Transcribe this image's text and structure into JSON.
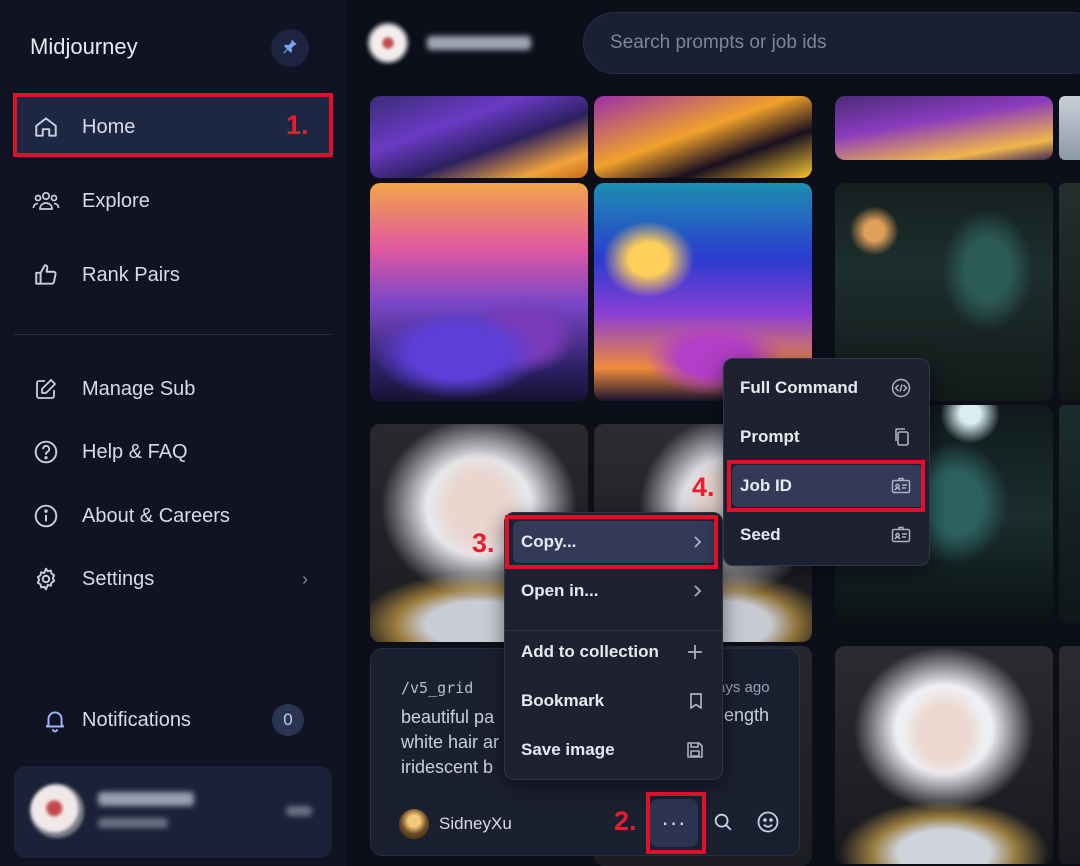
{
  "sidebar": {
    "brand": "Midjourney",
    "nav": [
      {
        "label": "Home",
        "icon": "home-icon"
      },
      {
        "label": "Explore",
        "icon": "people-icon"
      },
      {
        "label": "Rank Pairs",
        "icon": "thumbs-up-icon"
      },
      {
        "label": "Manage Sub",
        "icon": "edit-icon"
      },
      {
        "label": "Help & FAQ",
        "icon": "help-icon"
      },
      {
        "label": "About & Careers",
        "icon": "info-icon"
      },
      {
        "label": "Settings",
        "icon": "gear-icon"
      }
    ],
    "notifications": {
      "label": "Notifications",
      "count": "0"
    }
  },
  "search": {
    "placeholder": "Search prompts or job ids"
  },
  "detail": {
    "tag": "/v5_grid",
    "time_fragment": "ays ago",
    "prompt_lines": [
      "beautiful pa",
      "white hair ar",
      "iridescent b"
    ],
    "right_fragment": "ength",
    "author": "SidneyXu",
    "more_label": "···"
  },
  "context_menu": {
    "items": [
      {
        "label": "Copy...",
        "icon": "chevron-right-icon"
      },
      {
        "label": "Open in...",
        "icon": "chevron-right-icon"
      },
      {
        "label": "Add to collection",
        "icon": "plus-icon"
      },
      {
        "label": "Bookmark",
        "icon": "bookmark-icon"
      },
      {
        "label": "Save image",
        "icon": "save-icon"
      }
    ]
  },
  "copy_submenu": {
    "items": [
      {
        "label": "Full Command",
        "icon": "code-icon"
      },
      {
        "label": "Prompt",
        "icon": "copy-icon"
      },
      {
        "label": "Job ID",
        "icon": "id-card-icon"
      },
      {
        "label": "Seed",
        "icon": "id-card-icon"
      }
    ]
  },
  "annotations": [
    "1.",
    "2.",
    "3.",
    "4."
  ],
  "colors": {
    "accent": "#e0102b",
    "sidebar_bg": "#0f1322",
    "active_nav": "#1d2744",
    "menu_bg": "#1e2230",
    "menu_highlight": "#333a58"
  }
}
